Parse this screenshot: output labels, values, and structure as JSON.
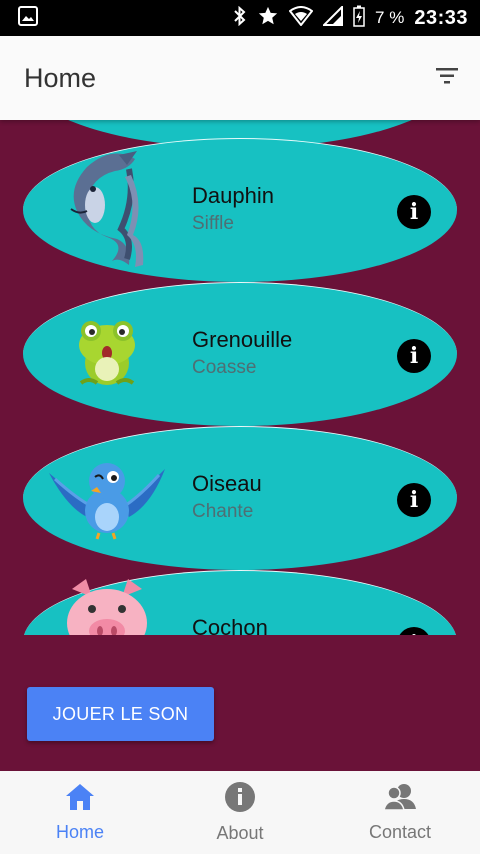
{
  "status_bar": {
    "battery_percent": "7 %",
    "time": "23:33"
  },
  "app_bar": {
    "title": "Home",
    "filter_icon": "filter-icon"
  },
  "animals": [
    {
      "name": "Dauphin",
      "sound": "Siffle",
      "icon": "dolphin-image"
    },
    {
      "name": "Grenouille",
      "sound": "Coasse",
      "icon": "frog-image"
    },
    {
      "name": "Oiseau",
      "sound": "Chante",
      "icon": "bird-image"
    },
    {
      "name": "Cochon",
      "sound": "",
      "icon": "pig-image"
    }
  ],
  "play_button": {
    "label": "JOUER LE SON"
  },
  "bottom_nav": {
    "items": [
      {
        "label": "Home",
        "icon": "home-icon",
        "active": true
      },
      {
        "label": "About",
        "icon": "info-icon",
        "active": false
      },
      {
        "label": "Contact",
        "icon": "contacts-icon",
        "active": false
      }
    ]
  },
  "colors": {
    "background": "#6a1238",
    "card": "#17c1c2",
    "accent": "#4b82f5"
  }
}
